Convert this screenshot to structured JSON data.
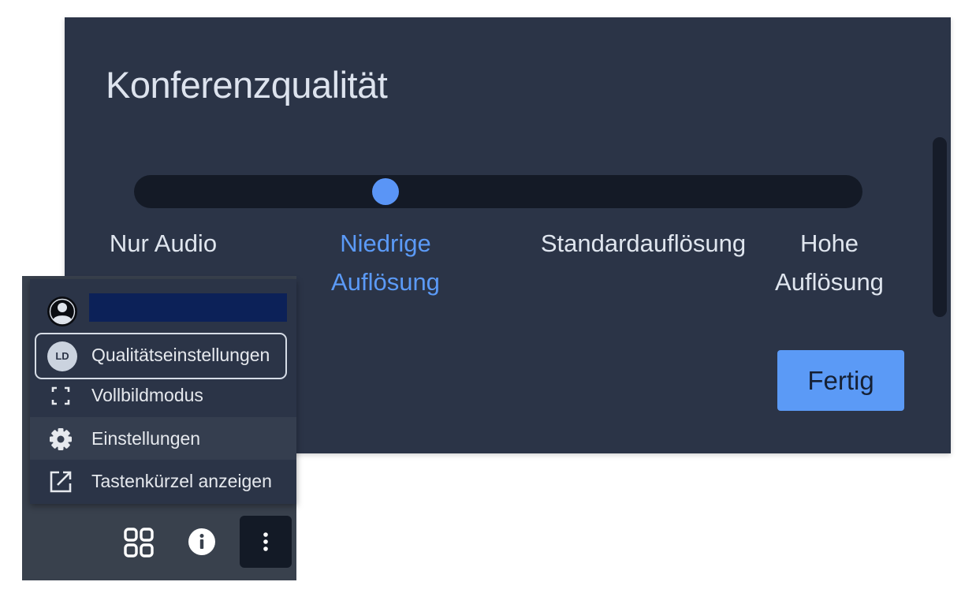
{
  "dialog": {
    "title": "Konferenzqualität",
    "quality_levels": [
      {
        "label": "Nur Audio",
        "active": false
      },
      {
        "label": "Niedrige Auflösung",
        "active": true
      },
      {
        "label": "Standardauflösung",
        "active": false
      },
      {
        "label": "Hohe Auflösung",
        "active": false
      }
    ],
    "selected_level_index": 1,
    "slider_fraction": 0.345,
    "done_label": "Fertig",
    "accent_color": "#5b9af6"
  },
  "menu": {
    "profile_icon": "user-circle-icon",
    "items": [
      {
        "icon": "avatar-ld",
        "avatar_initials": "LD",
        "label": "Qualitätseinstellungen",
        "focused": true
      },
      {
        "icon": "fullscreen-icon",
        "label": "Vollbildmodus"
      },
      {
        "icon": "gear-icon",
        "label": "Einstellungen",
        "highlighted": true
      },
      {
        "icon": "external-link-icon",
        "label": "Tastenkürzel anzeigen"
      }
    ]
  },
  "toolbar": {
    "buttons": [
      {
        "icon": "tile-view-icon"
      },
      {
        "icon": "info-icon"
      },
      {
        "icon": "more-vertical-icon",
        "active": true
      }
    ]
  }
}
